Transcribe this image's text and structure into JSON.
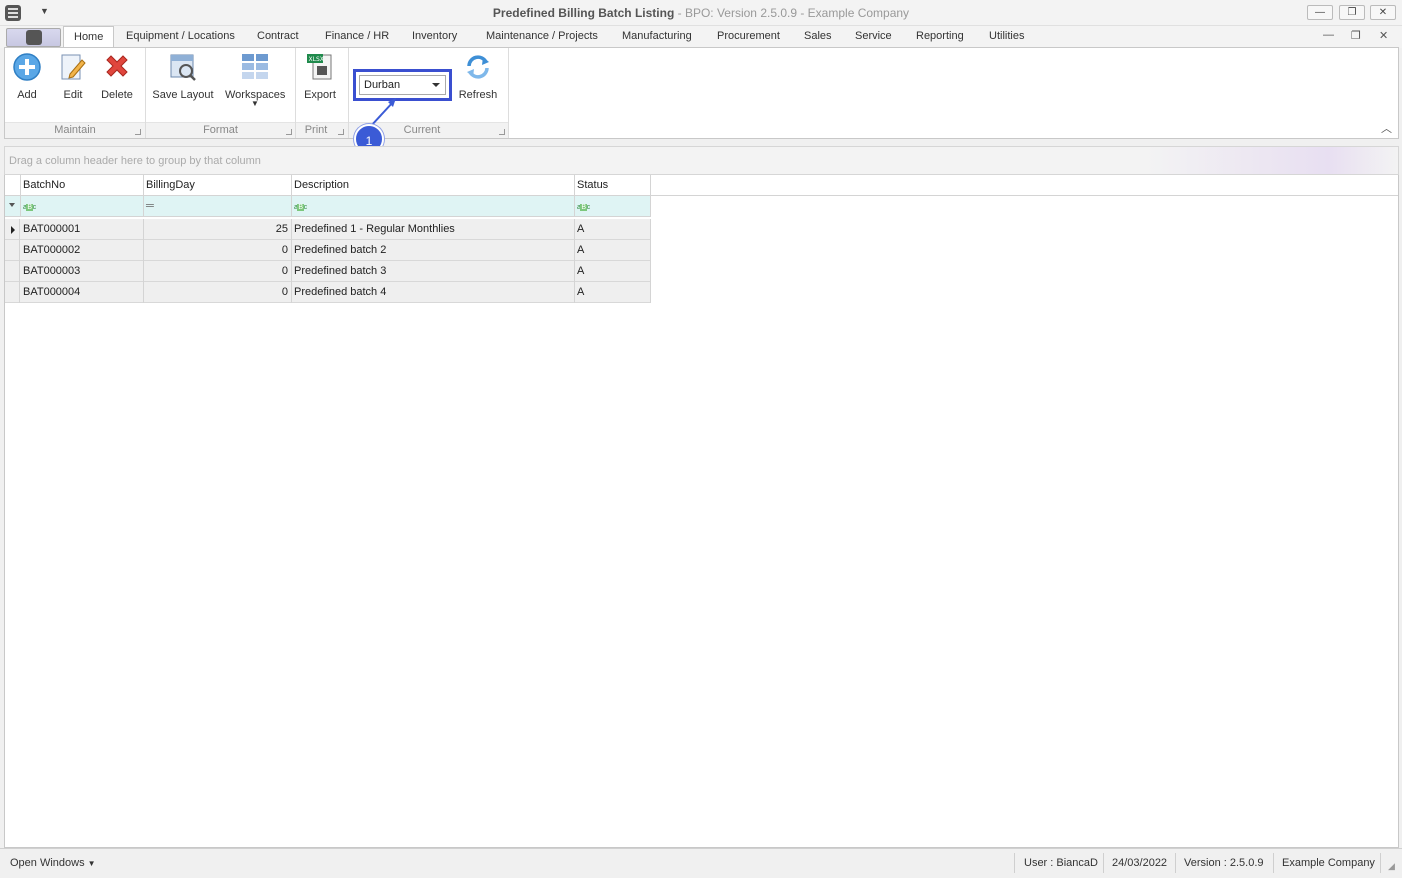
{
  "window": {
    "title_bold": "Predefined Billing Batch Listing",
    "title_rest": " - BPO: Version 2.5.0.9 - Example Company",
    "minimize": "—",
    "restore": "❐",
    "close": "✕"
  },
  "menu": {
    "tabs": [
      "Home",
      "Equipment / Locations",
      "Contract",
      "Finance / HR",
      "Inventory",
      "Maintenance / Projects",
      "Manufacturing",
      "Procurement",
      "Sales",
      "Service",
      "Reporting",
      "Utilities"
    ],
    "mdi_min": "—",
    "mdi_restore": "❐",
    "mdi_close": "✕"
  },
  "ribbon": {
    "buttons": {
      "add": "Add",
      "edit": "Edit",
      "delete": "Delete",
      "save_layout": "Save Layout",
      "workspaces": "Workspaces",
      "export": "Export",
      "refresh": "Refresh"
    },
    "groups": {
      "maintain": "Maintain",
      "format": "Format",
      "print": "Print",
      "current": "Current"
    },
    "branch": {
      "selected": "Durban"
    },
    "callout": "1"
  },
  "grid": {
    "group_hint": "Drag a column header here to group by that column",
    "columns": [
      "BatchNo",
      "BillingDay",
      "Description",
      "Status"
    ],
    "rows": [
      {
        "batch": "BAT000001",
        "day": "25",
        "desc": "Predefined 1 - Regular Monthlies",
        "status": "A"
      },
      {
        "batch": "BAT000002",
        "day": "0",
        "desc": "Predefined batch 2",
        "status": "A"
      },
      {
        "batch": "BAT000003",
        "day": "0",
        "desc": "Predefined batch 3",
        "status": "A"
      },
      {
        "batch": "BAT000004",
        "day": "0",
        "desc": "Predefined batch 4",
        "status": "A"
      }
    ]
  },
  "status": {
    "open_windows": "Open Windows",
    "user": "User : BiancaD",
    "date": "24/03/2022",
    "version": "Version : 2.5.0.9",
    "company": "Example Company"
  },
  "colors": {
    "accent": "#3a4fd0",
    "callout": "#3b5bd6",
    "filter_row": "#dff4f4"
  }
}
